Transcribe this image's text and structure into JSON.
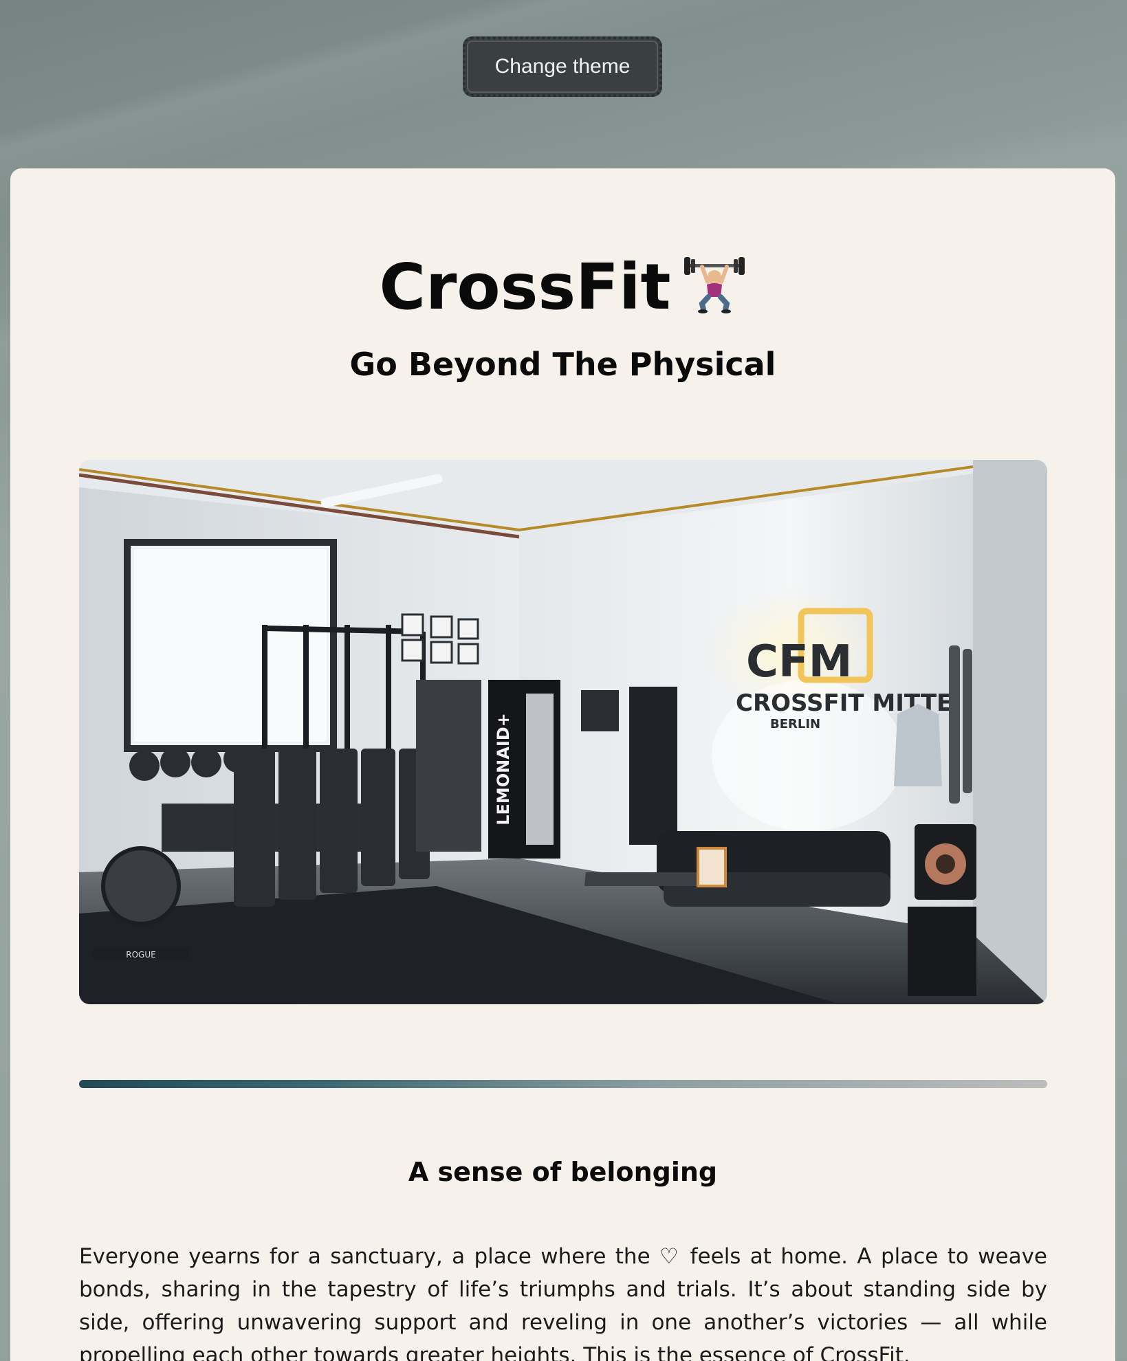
{
  "header": {
    "theme_button_label": "Change theme"
  },
  "hero": {
    "title": "CrossFit",
    "title_emoji": "woman-lifting-weights-icon",
    "subtitle": "Go Beyond The Physical"
  },
  "photo": {
    "sign_logo": "CFM",
    "sign_name": "CROSSFIT MITTE",
    "sign_city": "BERLIN",
    "fridge_brand": "LEMONAID+",
    "bike_brand": "ROGUE"
  },
  "section": {
    "heading": "A sense of belonging",
    "body": "Everyone yearns for a sanctuary, a place where the ♡ feels at home. A place to weave bonds, sharing in the tapestry of life’s triumphs and trials. It’s about standing side by side, offering unwavering support and reveling in one another’s victories — all while propelling each other towards greater heights. This is the essence of CrossFit."
  },
  "colors": {
    "card_background": "#f7f1ec",
    "button_background": "#3a3f41",
    "divider_start": "#214a55",
    "divider_end": "#bdbdbd"
  }
}
